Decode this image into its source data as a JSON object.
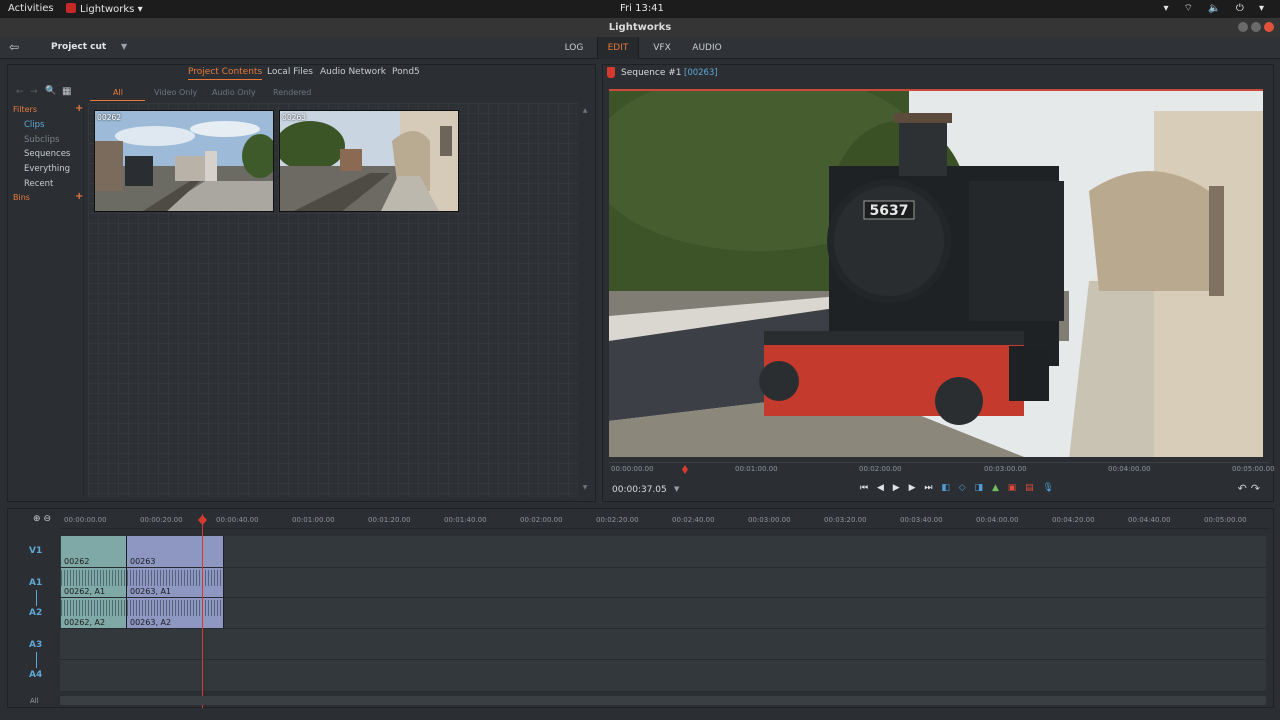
{
  "system": {
    "activities": "Activities",
    "app_name": "Lightworks",
    "app_menu_arrow": "▾",
    "clock": "Fri 13:41",
    "tray": "▾  ⌔ 🔈 ⏻ ▾"
  },
  "window": {
    "title": "Lightworks"
  },
  "menubar": {
    "exit_icon": "⇦",
    "project_name": "Project cut",
    "project_dropdown": "▼",
    "tabs": [
      {
        "label": "LOG"
      },
      {
        "label": "EDIT"
      },
      {
        "label": "VFX"
      },
      {
        "label": "AUDIO"
      }
    ]
  },
  "content_panel": {
    "tabs": [
      "Project Contents",
      "Local Files",
      "Audio Network",
      "Pond5"
    ],
    "filters": [
      "All",
      "Video Only",
      "Audio Only",
      "Rendered"
    ],
    "toolbar": {
      "back": "←",
      "forward": "→",
      "search": "🔍",
      "view": "▦"
    },
    "sidebar": {
      "filters_heading": "Filters",
      "items": [
        "Clips",
        "Subclips",
        "Sequences",
        "Everything",
        "Recent"
      ],
      "bins_heading": "Bins",
      "plus": "+"
    },
    "scroll_up": "▲",
    "scroll_down": "▼",
    "thumbnails": [
      {
        "label": "00262"
      },
      {
        "label": "00263"
      }
    ]
  },
  "viewer": {
    "title": "Sequence #1",
    "clip_id": "[00263]",
    "ruler": [
      "00:00:00.00",
      "00:01:00.00",
      "00:02:00.00",
      "00:03:00.00",
      "00:04:00.00",
      "00:05:00.00"
    ],
    "timecode": "00:00:37.05",
    "timecode_dropdown": "▼",
    "transport": {
      "start": "⏮",
      "back": "◀",
      "play": "▶",
      "forward": "▶",
      "end": "⏭"
    },
    "undo": "↶",
    "redo": "↷",
    "locomotive_number": "5637"
  },
  "timeline": {
    "zoom_in": "⊕",
    "zoom_out": "⊖",
    "ruler": [
      "00:00:00.00",
      "00:00:20.00",
      "00:00:40.00",
      "00:01:00.00",
      "00:01:20.00",
      "00:01:40.00",
      "00:02:00.00",
      "00:02:20.00",
      "00:02:40.00",
      "00:03:00.00",
      "00:03:20.00",
      "00:03:40.00",
      "00:04:00.00",
      "00:04:20.00",
      "00:04:40.00",
      "00:05:00.00"
    ],
    "tracks": [
      "V1",
      "A1",
      "A2",
      "A3",
      "A4"
    ],
    "clips": {
      "v1": [
        "00262",
        "00263"
      ],
      "a1": [
        "00262, A1",
        "00263, A1"
      ],
      "a2": [
        "00262, A2",
        "00263, A2"
      ]
    },
    "all_label": "All"
  },
  "colors": {
    "accent": "#e8793a",
    "blue": "#5fa8d6",
    "playhead": "#d63a2f"
  }
}
